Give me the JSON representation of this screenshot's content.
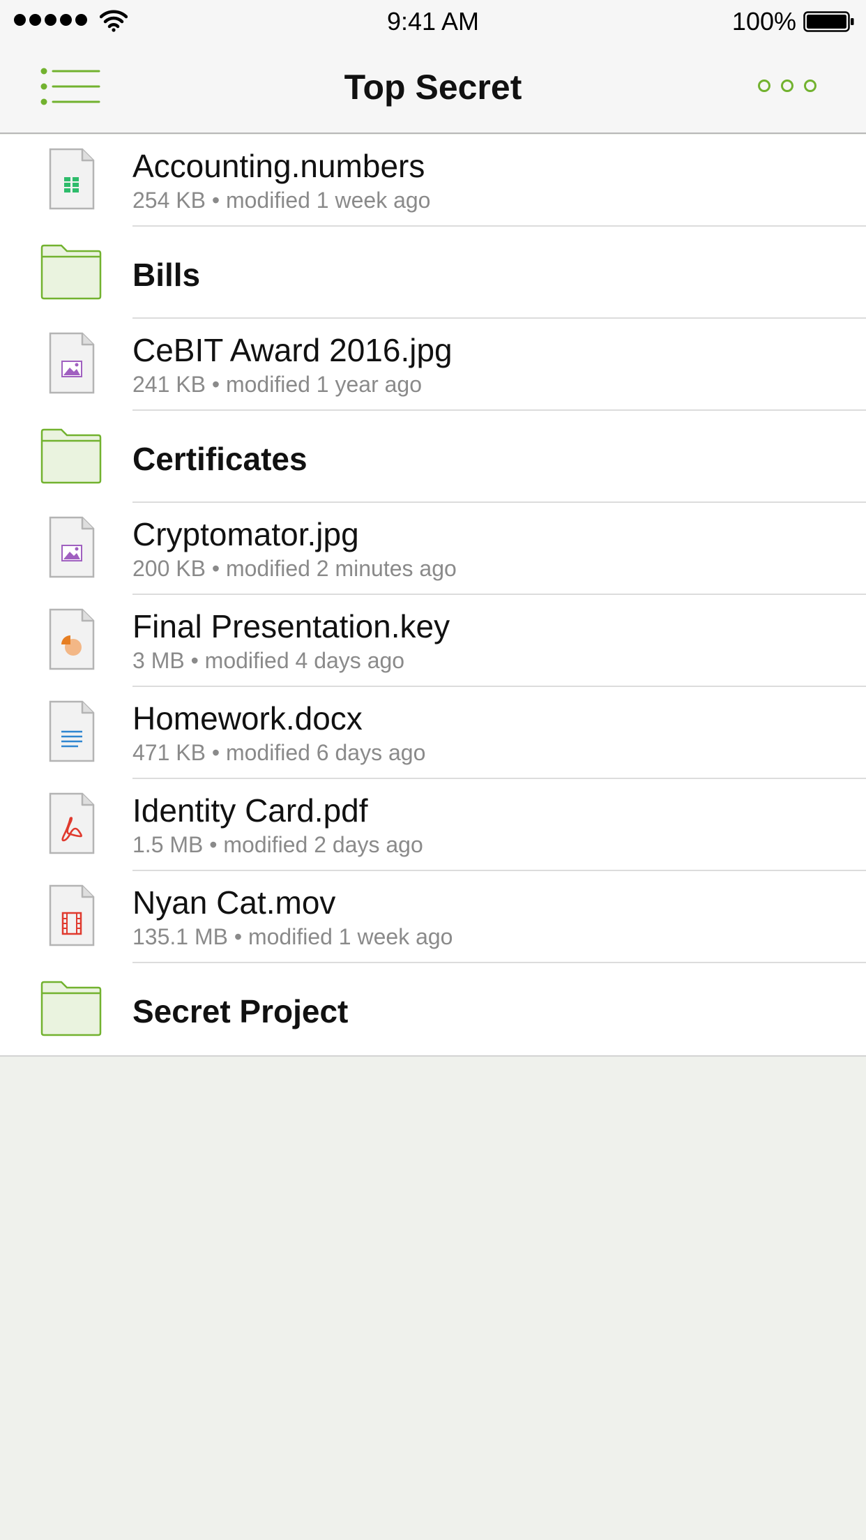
{
  "status_bar": {
    "time": "9:41 AM",
    "battery": "100%"
  },
  "nav": {
    "title": "Top Secret",
    "menu_icon": "list-menu-icon",
    "more_icon": "more-options-icon"
  },
  "colors": {
    "accent": "#72b22f",
    "folder_fill": "#eaf3df"
  },
  "items": [
    {
      "name": "Accounting.numbers",
      "meta": "254 KB • modified 1 week ago",
      "type": "file",
      "icon": "spreadsheet-file-icon"
    },
    {
      "name": "Bills",
      "meta": "",
      "type": "folder",
      "icon": "folder-icon"
    },
    {
      "name": "CeBIT Award 2016.jpg",
      "meta": "241 KB • modified 1 year ago",
      "type": "file",
      "icon": "image-file-icon"
    },
    {
      "name": "Certificates",
      "meta": "",
      "type": "folder",
      "icon": "folder-icon"
    },
    {
      "name": "Cryptomator.jpg",
      "meta": "200 KB • modified 2 minutes ago",
      "type": "file",
      "icon": "image-file-icon"
    },
    {
      "name": "Final Presentation.key",
      "meta": "3 MB • modified 4 days ago",
      "type": "file",
      "icon": "presentation-file-icon"
    },
    {
      "name": "Homework.docx",
      "meta": "471 KB • modified 6 days ago",
      "type": "file",
      "icon": "document-file-icon"
    },
    {
      "name": "Identity Card.pdf",
      "meta": "1.5 MB • modified 2 days ago",
      "type": "file",
      "icon": "pdf-file-icon"
    },
    {
      "name": "Nyan Cat.mov",
      "meta": "135.1 MB • modified 1 week ago",
      "type": "file",
      "icon": "video-file-icon"
    },
    {
      "name": "Secret Project",
      "meta": "",
      "type": "folder",
      "icon": "folder-icon"
    }
  ]
}
